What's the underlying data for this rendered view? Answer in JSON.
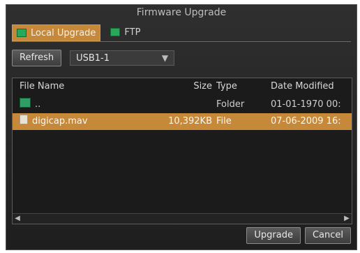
{
  "window": {
    "title": "Firmware Upgrade"
  },
  "tabs": [
    {
      "label": "Local Upgrade",
      "icon": "local-upgrade-icon",
      "active": true
    },
    {
      "label": "FTP",
      "icon": "ftp-icon",
      "active": false
    }
  ],
  "toolbar": {
    "refresh_label": "Refresh",
    "device_value": "USB1-1",
    "device_icon": "chevron-down-icon"
  },
  "file_list": {
    "columns": [
      "File Name",
      "Size",
      "Type",
      "Date Modified"
    ],
    "rows": [
      {
        "name": "..",
        "size": "",
        "type": "Folder",
        "date": "01-01-1970 00:",
        "selected": false,
        "icon": "folder-icon"
      },
      {
        "name": "digicap.mav",
        "size": "10,392KB",
        "type": "File",
        "date": "07-06-2009 16:",
        "selected": true,
        "icon": "file-icon"
      }
    ],
    "hscroll": {
      "left_icon": "arrow-left-icon",
      "right_icon": "arrow-right-icon"
    }
  },
  "actions": {
    "upgrade_label": "Upgrade",
    "cancel_label": "Cancel"
  },
  "colors": {
    "accent": "#c6893a",
    "window_bg": "#252525",
    "text": "#d0d0d0"
  }
}
